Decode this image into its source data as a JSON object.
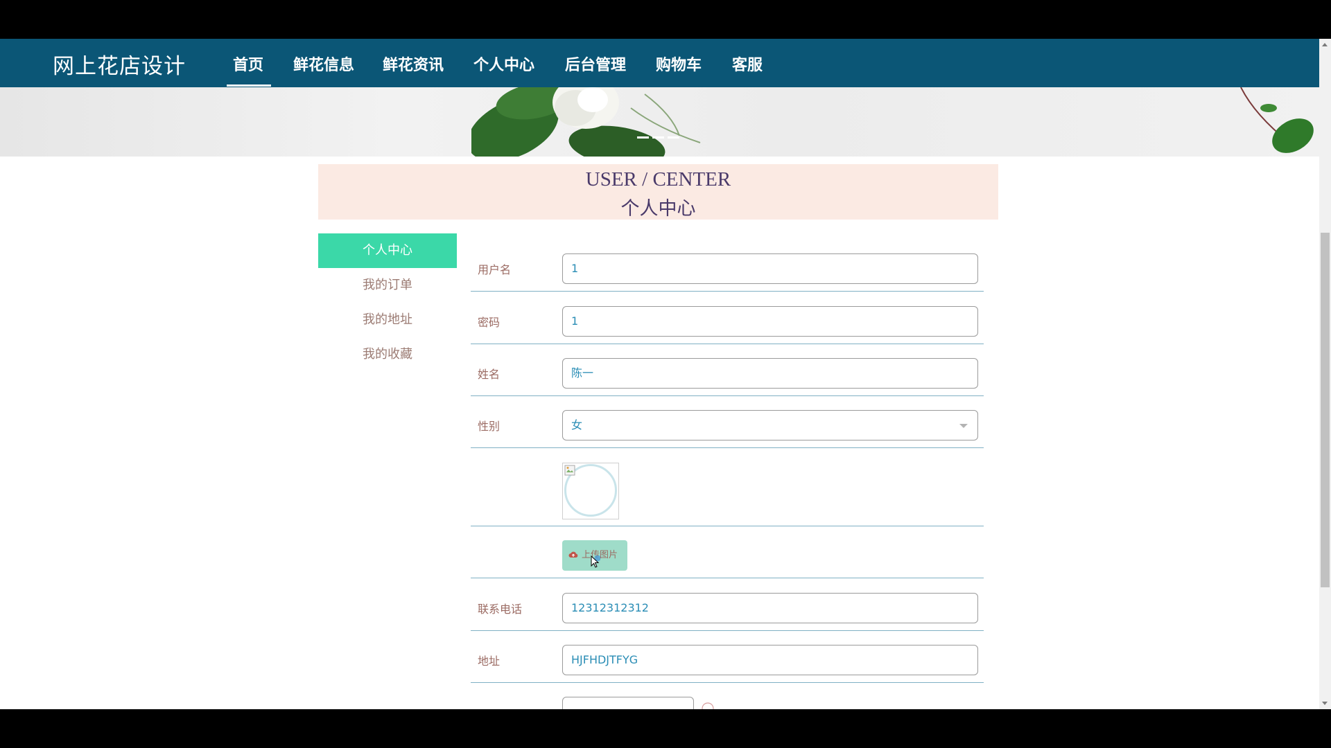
{
  "nav": {
    "brand": "网上花店设计",
    "items": [
      {
        "label": "首页",
        "active": true
      },
      {
        "label": "鲜花信息"
      },
      {
        "label": "鲜花资讯"
      },
      {
        "label": "个人中心"
      },
      {
        "label": "后台管理"
      },
      {
        "label": "购物车"
      },
      {
        "label": "客服"
      }
    ]
  },
  "header": {
    "title_en": "USER / CENTER",
    "title_cn": "个人中心"
  },
  "sidebar": {
    "items": [
      {
        "label": "个人中心",
        "active": true
      },
      {
        "label": "我的订单"
      },
      {
        "label": "我的地址"
      },
      {
        "label": "我的收藏"
      }
    ]
  },
  "form": {
    "username": {
      "label": "用户名",
      "value": "1"
    },
    "password": {
      "label": "密码",
      "value": "1"
    },
    "name": {
      "label": "姓名",
      "value": "陈一"
    },
    "gender": {
      "label": "性别",
      "value": "女"
    },
    "upload_button": "上传图片",
    "phone": {
      "label": "联系电话",
      "value": "12312312312"
    },
    "address": {
      "label": "地址",
      "value": "HJFHDJTFYG"
    }
  },
  "colors": {
    "nav_bg": "#0b5676",
    "accent": "#3bd8a8",
    "header_bg": "#fbeae3",
    "text_muted": "#9b7b73",
    "input_text": "#2a8db5"
  }
}
